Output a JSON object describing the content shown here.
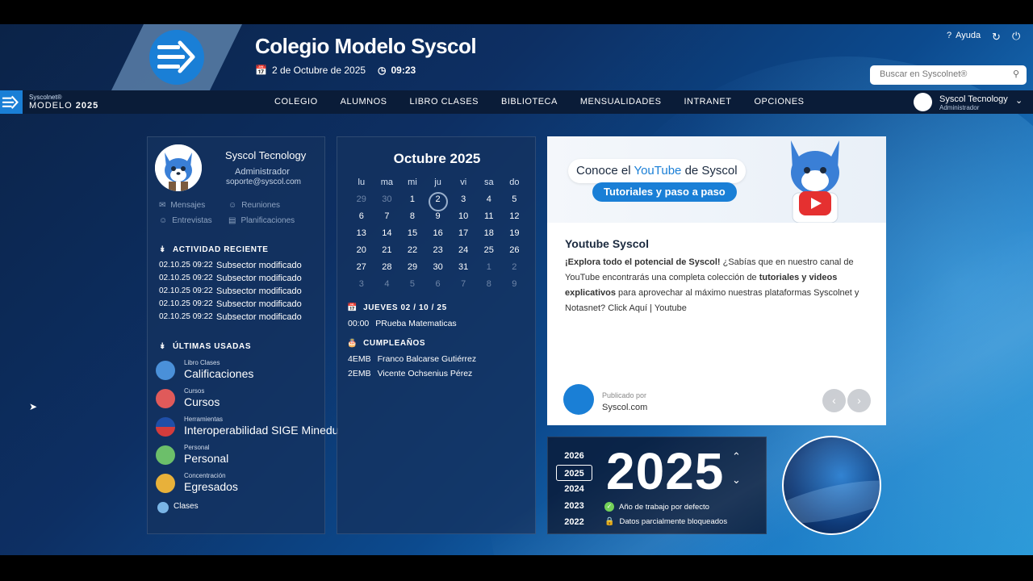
{
  "header": {
    "school_name": "Colegio Modelo Syscol",
    "date": "2 de Octubre de 2025",
    "time": "09:23",
    "help_label": "Ayuda",
    "search_placeholder": "Buscar en Syscolnet®"
  },
  "navbar": {
    "brand_top": "Syscolnet®",
    "brand_model": "MODELO",
    "brand_year": "2025",
    "items": [
      "COLEGIO",
      "ALUMNOS",
      "LIBRO CLASES",
      "BIBLIOTECA",
      "MENSUALIDADES",
      "INTRANET",
      "OPCIONES"
    ],
    "user_name": "Syscol Tecnology",
    "user_role": "Administrador"
  },
  "profile": {
    "name": "Syscol Tecnology",
    "role": "Administrador",
    "email": "soporte@syscol.com",
    "quick_links": [
      "Mensajes",
      "Reuniones",
      "Entrevistas",
      "Planificaciones"
    ],
    "activity_title": "ACTIVIDAD RECIENTE",
    "activity": [
      {
        "date": "02.10.25 09:22",
        "text": "Subsector modificado"
      },
      {
        "date": "02.10.25 09:22",
        "text": "Subsector modificado"
      },
      {
        "date": "02.10.25 09:22",
        "text": "Subsector modificado"
      },
      {
        "date": "02.10.25 09:22",
        "text": "Subsector modificado"
      },
      {
        "date": "02.10.25 09:22",
        "text": "Subsector modificado"
      }
    ],
    "recent_title": "ÚLTIMAS USADAS",
    "recent": [
      {
        "category": "Libro Clases",
        "name": "Calificaciones",
        "color": "#4a90d9"
      },
      {
        "category": "Cursos",
        "name": "Cursos",
        "color": "#e05a5a"
      },
      {
        "category": "Herramientas",
        "name": "Interoperabilidad SIGE Minedu",
        "color": "#d43c3c"
      },
      {
        "category": "Personal",
        "name": "Personal",
        "color": "#6cbf6a"
      },
      {
        "category": "Concentración",
        "name": "Egresados",
        "color": "#e8b13a"
      }
    ],
    "clases_label": "Clases"
  },
  "calendar": {
    "month": "Octubre",
    "year": "2025",
    "weekdays": [
      "lu",
      "ma",
      "mi",
      "ju",
      "vi",
      "sa",
      "do"
    ],
    "days": [
      [
        "29",
        "m"
      ],
      [
        "30",
        "m"
      ],
      [
        "1",
        ""
      ],
      [
        "2",
        "t"
      ],
      [
        "3",
        ""
      ],
      [
        "4",
        ""
      ],
      [
        "5",
        ""
      ],
      [
        "6",
        ""
      ],
      [
        "7",
        ""
      ],
      [
        "8",
        ""
      ],
      [
        "9",
        ""
      ],
      [
        "10",
        ""
      ],
      [
        "11",
        ""
      ],
      [
        "12",
        ""
      ],
      [
        "13",
        ""
      ],
      [
        "14",
        ""
      ],
      [
        "15",
        ""
      ],
      [
        "16",
        ""
      ],
      [
        "17",
        ""
      ],
      [
        "18",
        ""
      ],
      [
        "19",
        ""
      ],
      [
        "20",
        ""
      ],
      [
        "21",
        ""
      ],
      [
        "22",
        ""
      ],
      [
        "23",
        ""
      ],
      [
        "24",
        ""
      ],
      [
        "25",
        ""
      ],
      [
        "26",
        ""
      ],
      [
        "27",
        ""
      ],
      [
        "28",
        ""
      ],
      [
        "29",
        ""
      ],
      [
        "30",
        ""
      ],
      [
        "31",
        ""
      ],
      [
        "1",
        "m"
      ],
      [
        "2",
        "m"
      ],
      [
        "3",
        "m"
      ],
      [
        "4",
        "m"
      ],
      [
        "5",
        "m"
      ],
      [
        "6",
        "m"
      ],
      [
        "7",
        "m"
      ],
      [
        "8",
        "m"
      ],
      [
        "9",
        "m"
      ]
    ],
    "event_day_label": "JUEVES 02 / 10 / 25",
    "events": [
      {
        "time": "00:00",
        "text": "PRueba Matematicas"
      }
    ],
    "birthdays_label": "CUMPLEAÑOS",
    "birthdays": [
      {
        "course": "4EMB",
        "name": "Franco Balcarse Gutiérrez"
      },
      {
        "course": "2EMB",
        "name": "Vicente Ochsenius Pérez"
      }
    ]
  },
  "youtube": {
    "banner_prefix": "Conoce el",
    "banner_brand": "YouTube",
    "banner_suffix": "de Syscol",
    "banner_button": "Tutoriales y paso a paso",
    "title": "Youtube Syscol",
    "body_bold1": "¡Explora todo el potencial de Syscol!",
    "body_text1": " ¿Sabías que en nuestro canal de YouTube encontrarás una completa colección de ",
    "body_bold2": "tutoriales y videos explicativos",
    "body_text2": " para aprovechar al máximo nuestras plataformas Syscolnet y Notasnet? Click Aquí | Youtube",
    "published_by": "Publicado por",
    "publisher": "Syscol.com"
  },
  "year_selector": {
    "years": [
      "2026",
      "2025",
      "2024",
      "2023",
      "2022"
    ],
    "selected": "2025",
    "big_year": "2025",
    "note_default": "Año de trabajo por defecto",
    "note_locked": "Datos parcialmente bloqueados"
  }
}
